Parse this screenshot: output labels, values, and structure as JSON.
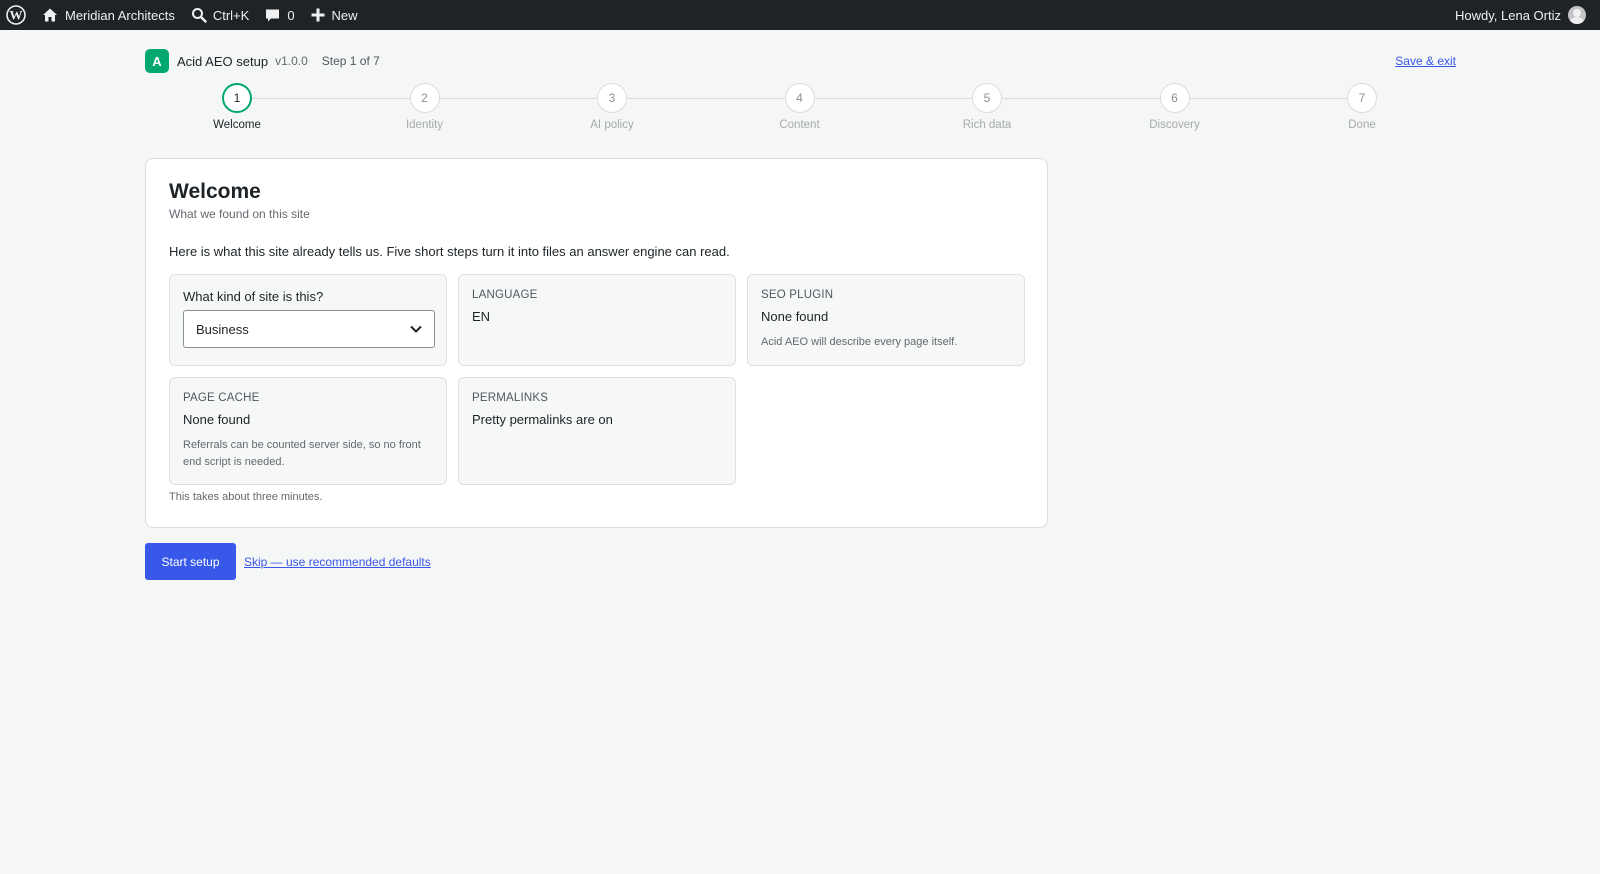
{
  "adminbar": {
    "site_name": "Meridian Architects",
    "search_shortcut": "Ctrl+K",
    "comments_count": "0",
    "new_label": "New",
    "greeting": "Howdy, Lena Ortiz"
  },
  "header": {
    "logo_letter": "A",
    "plugin_name": "Acid AEO setup",
    "version": "v1.0.0",
    "step_counter": "Step 1 of 7",
    "save_exit": "Save & exit"
  },
  "steps": [
    {
      "number": "1",
      "label": "Welcome"
    },
    {
      "number": "2",
      "label": "Identity"
    },
    {
      "number": "3",
      "label": "AI policy"
    },
    {
      "number": "4",
      "label": "Content"
    },
    {
      "number": "5",
      "label": "Rich data"
    },
    {
      "number": "6",
      "label": "Discovery"
    },
    {
      "number": "7",
      "label": "Done"
    }
  ],
  "card": {
    "title": "Welcome",
    "subtitle": "What we found on this site",
    "intro": "Here is what this site already tells us. Five short steps turn it into files an answer engine can read.",
    "site_kind": {
      "question": "What kind of site is this?",
      "selected": "Business"
    },
    "language": {
      "label": "LANGUAGE",
      "value": "EN"
    },
    "seo_plugin": {
      "label": "SEO PLUGIN",
      "value": "None found",
      "note": "Acid AEO will describe every page itself."
    },
    "page_cache": {
      "label": "PAGE CACHE",
      "value": "None found",
      "note": "Referrals can be counted server side, so no front end script is needed."
    },
    "permalinks": {
      "label": "PERMALINKS",
      "value": "Pretty permalinks are on"
    },
    "footnote": "This takes about three minutes."
  },
  "actions": {
    "start": "Start setup",
    "skip": "Skip — use recommended defaults"
  },
  "colors": {
    "adminbar": "#1d2327",
    "accent_green": "#00a870",
    "primary_blue": "#3858e9"
  }
}
